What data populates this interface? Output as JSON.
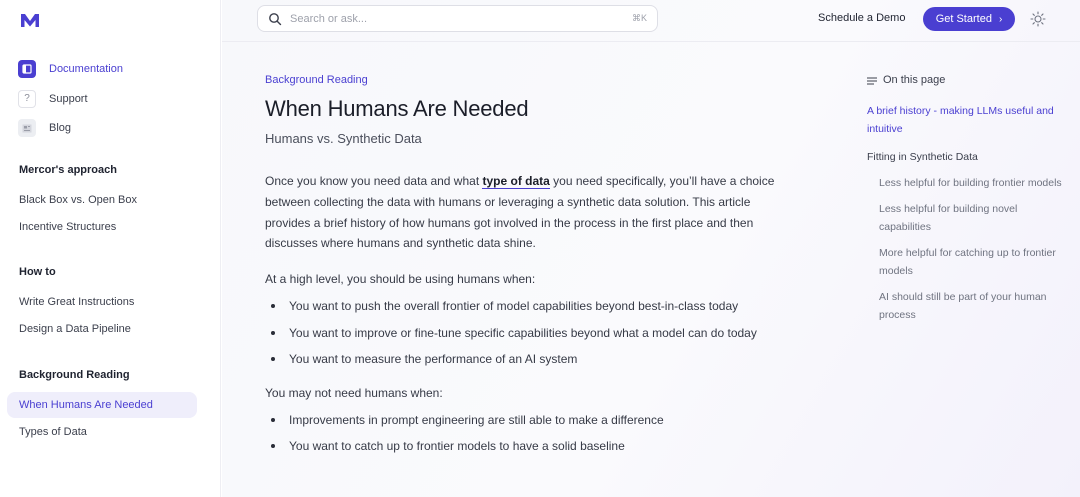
{
  "brand": {
    "accent": "#4a3fd1"
  },
  "sidebar": {
    "top_items": [
      {
        "label": "Documentation",
        "icon": "book-icon",
        "active": true
      },
      {
        "label": "Support",
        "icon": "question-icon"
      },
      {
        "label": "Blog",
        "icon": "newspaper-icon"
      }
    ],
    "sections": [
      {
        "title": "Mercor's approach",
        "links": [
          "Black Box vs. Open Box",
          "Incentive Structures"
        ]
      },
      {
        "title": "How to",
        "links": [
          "Write Great Instructions",
          "Design a Data Pipeline"
        ]
      },
      {
        "title": "Background Reading",
        "links": [
          "When Humans Are Needed",
          "Types of Data"
        ]
      }
    ]
  },
  "header": {
    "search_placeholder": "Search or ask...",
    "search_shortcut": "⌘K",
    "schedule_demo": "Schedule a Demo",
    "get_started": "Get Started",
    "get_started_chevron": "›"
  },
  "article": {
    "eyebrow": "Background Reading",
    "title": "When Humans Are Needed",
    "subtitle": "Humans vs. Synthetic Data",
    "intro_before_link": "Once you know you need data and what ",
    "intro_link": "type of data",
    "intro_after_link": " you need specifically, you’ll have a choice between collecting the data with humans or leveraging a synthetic data solution. This article provides a brief history of how humans got involved in the process in the first place and then discusses where humans and synthetic data shine.",
    "use_humans_lead": "At a high level, you should be using humans when:",
    "use_humans": [
      "You want to push the overall frontier of model capabilities beyond best-in-class today",
      "You want to improve or fine-tune specific capabilities beyond what a model can do today",
      "You want to measure the performance of an AI system"
    ],
    "no_humans_lead": "You may not need humans when:",
    "no_humans": [
      "Improvements in prompt engineering are still able to make a difference",
      "You want to catch up to frontier models to have a solid baseline"
    ]
  },
  "toc": {
    "heading": "On this page",
    "items": [
      {
        "label": "A brief history - making LLMs useful and intuitive",
        "level": 0,
        "active": true
      },
      {
        "label": "Fitting in Synthetic Data",
        "level": 0
      },
      {
        "label": "Less helpful for building frontier models",
        "level": 1
      },
      {
        "label": "Less helpful for building novel capabilities",
        "level": 1
      },
      {
        "label": "More helpful for catching up to frontier models",
        "level": 1
      },
      {
        "label": "AI should still be part of your human process",
        "level": 1
      }
    ]
  }
}
